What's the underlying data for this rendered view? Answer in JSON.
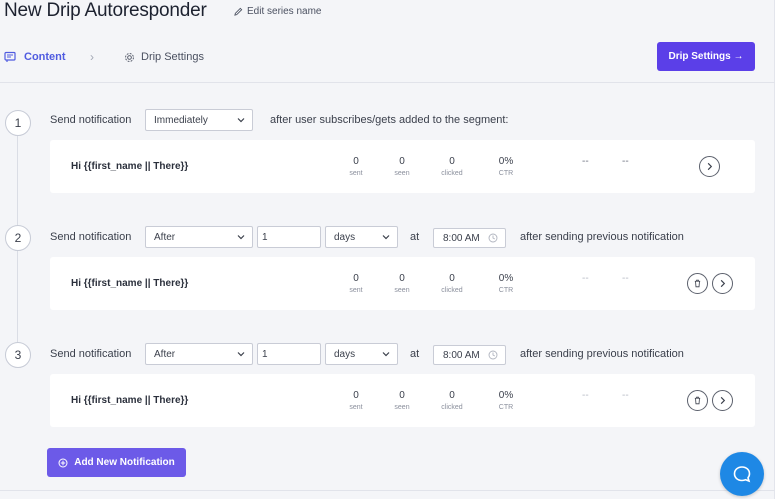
{
  "header": {
    "title": "New Drip Autoresponder",
    "edit_series_label": "Edit series name"
  },
  "tabs": {
    "content_label": "Content",
    "drip_settings_label": "Drip Settings",
    "drip_settings_button": "Drip Settings →"
  },
  "steps": [
    {
      "number": "1",
      "label": "Send notification",
      "timing": "Immediately",
      "suffix": "after user subscribes/gets added to the segment:",
      "subject": "Hi {{first_name || There}}",
      "stats": {
        "sent": "0",
        "seen": "0",
        "clicked": "0",
        "ctr": "0%"
      },
      "stat_labels": {
        "sent": "sent",
        "seen": "seen",
        "clicked": "clicked",
        "ctr": "CTR"
      },
      "dash1": "--",
      "dash2": "--"
    },
    {
      "number": "2",
      "label": "Send notification",
      "timing": "After",
      "amount": "1",
      "unit": "days",
      "at_label": "at",
      "time": "8:00 AM",
      "suffix": "after sending previous notification",
      "subject": "Hi {{first_name || There}}",
      "stats": {
        "sent": "0",
        "seen": "0",
        "clicked": "0",
        "ctr": "0%"
      },
      "stat_labels": {
        "sent": "sent",
        "seen": "seen",
        "clicked": "clicked",
        "ctr": "CTR"
      },
      "dash1": "--",
      "dash2": "--"
    },
    {
      "number": "3",
      "label": "Send notification",
      "timing": "After",
      "amount": "1",
      "unit": "days",
      "at_label": "at",
      "time": "8:00 AM",
      "suffix": "after sending previous notification",
      "subject": "Hi {{first_name || There}}",
      "stats": {
        "sent": "0",
        "seen": "0",
        "clicked": "0",
        "ctr": "0%"
      },
      "stat_labels": {
        "sent": "sent",
        "seen": "seen",
        "clicked": "clicked",
        "ctr": "CTR"
      },
      "dash1": "--",
      "dash2": "--"
    }
  ],
  "add_notification_label": "Add New Notification",
  "colors": {
    "primary": "#5b3fe8",
    "accent_text": "#4f5be0",
    "chat": "#1e88e5"
  },
  "icons": [
    "pencil-icon",
    "content-icon",
    "gear-icon",
    "chevron-down-icon",
    "clock-icon",
    "trash-icon",
    "chevron-right-icon",
    "plus-circle-icon",
    "chat-icon"
  ]
}
